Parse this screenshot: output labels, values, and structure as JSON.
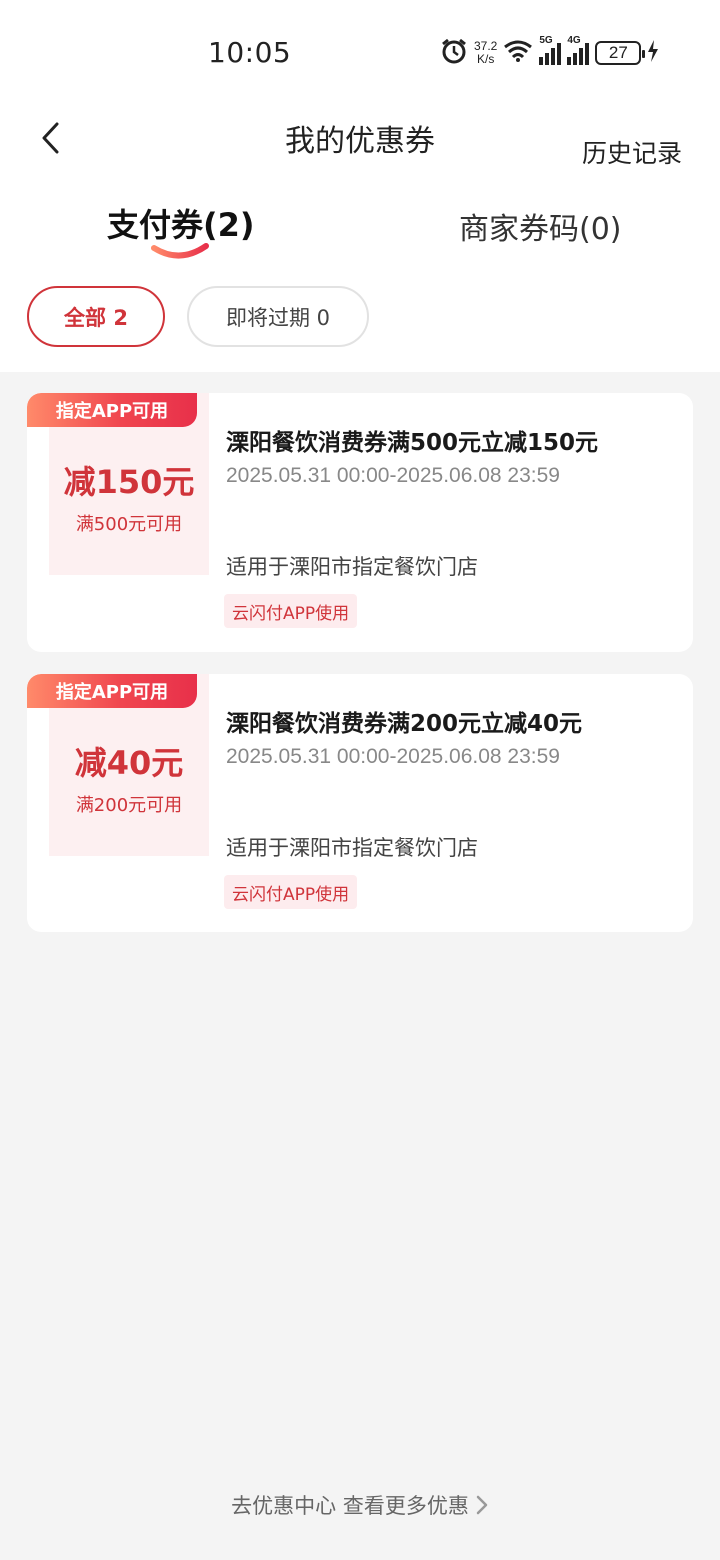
{
  "status_bar": {
    "time": "10:05",
    "net_speed_value": "37.2",
    "net_speed_unit": "K/s",
    "signal_1_label": "5G",
    "signal_2_label": "4G",
    "battery_level": "27"
  },
  "header": {
    "title": "我的优惠券",
    "history_label": "历史记录"
  },
  "tabs": [
    {
      "label": "支付券(2)",
      "active": true
    },
    {
      "label": "商家券码(0)",
      "active": false
    }
  ],
  "filters": [
    {
      "label": "全部 2",
      "selected": true
    },
    {
      "label": "即将过期 0",
      "selected": false
    }
  ],
  "coupons": [
    {
      "badge": "指定APP可用",
      "amount": "减150元",
      "condition": "满500元可用",
      "title": "溧阳餐饮消费券满500元立减150元",
      "validity": "2025.05.31 00:00-2025.06.08 23:59",
      "scope": "适用于溧阳市指定餐饮门店",
      "tag": "云闪付APP使用"
    },
    {
      "badge": "指定APP可用",
      "amount": "减40元",
      "condition": "满200元可用",
      "title": "溧阳餐饮消费券满200元立减40元",
      "validity": "2025.05.31 00:00-2025.06.08 23:59",
      "scope": "适用于溧阳市指定餐饮门店",
      "tag": "云闪付APP使用"
    }
  ],
  "footer": {
    "link_label": "去优惠中心 查看更多优惠"
  },
  "colors": {
    "accent": "#d0343a",
    "badge_gradient_start": "#ff8a6a",
    "badge_gradient_end": "#e8304a",
    "coupon_left_bg": "#fdf0f1",
    "page_bg": "#f4f4f4"
  }
}
